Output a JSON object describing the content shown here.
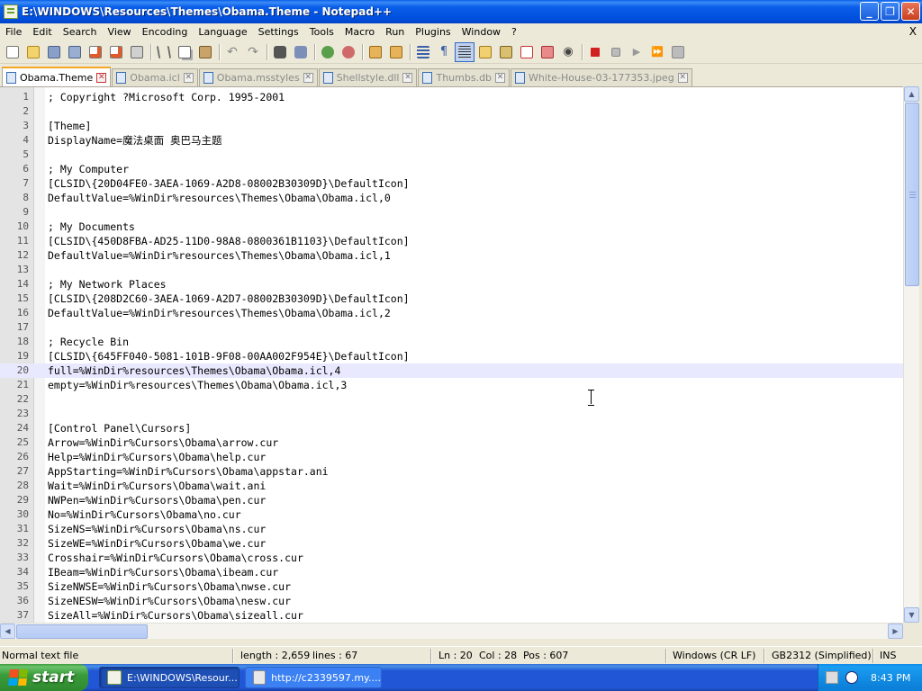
{
  "window": {
    "title": "E:\\WINDOWS\\Resources\\Themes\\Obama.Theme - Notepad++",
    "min_label": "_",
    "max_label": "❐",
    "close_label": "✕"
  },
  "menu": {
    "items": [
      "File",
      "Edit",
      "Search",
      "View",
      "Encoding",
      "Language",
      "Settings",
      "Tools",
      "Macro",
      "Run",
      "Plugins",
      "Window",
      "?"
    ],
    "close_label": "X"
  },
  "toolbar": {
    "icons": [
      "new-file-icon",
      "open-file-icon",
      "save-icon",
      "save-all-icon",
      "close-icon",
      "close-all-icon",
      "print-icon",
      "cut-icon",
      "copy-icon",
      "paste-icon",
      "undo-icon",
      "redo-icon",
      "find-icon",
      "replace-icon",
      "zoom-in-icon",
      "zoom-out-icon",
      "sync-vertical-icon",
      "sync-horizontal-icon",
      "word-wrap-icon",
      "show-all-chars-icon",
      "indent-guide-icon",
      "user-lang-icon",
      "doc-map-icon",
      "function-list-icon",
      "folder-workspace-icon",
      "monitoring-icon",
      "record-macro-icon",
      "stop-record-icon",
      "play-macro-icon",
      "play-multiple-icon",
      "save-macro-icon"
    ]
  },
  "tabs": [
    {
      "label": "Obama.Theme",
      "active": true
    },
    {
      "label": "Obama.icl",
      "active": false
    },
    {
      "label": "Obama.msstyles",
      "active": false
    },
    {
      "label": "Shellstyle.dll",
      "active": false
    },
    {
      "label": "Thumbs.db",
      "active": false
    },
    {
      "label": "White-House-03-177353.jpeg",
      "active": false
    }
  ],
  "editor": {
    "current_line": 20,
    "lines": [
      {
        "n": "1",
        "text": "; Copyright ?Microsoft Corp. 1995-2001"
      },
      {
        "n": "2",
        "text": ""
      },
      {
        "n": "3",
        "text": "[Theme]"
      },
      {
        "n": "4",
        "text": "DisplayName=魔法桌面 奥巴马主题"
      },
      {
        "n": "5",
        "text": ""
      },
      {
        "n": "6",
        "text": "; My Computer"
      },
      {
        "n": "7",
        "text": "[CLSID\\{20D04FE0-3AEA-1069-A2D8-08002B30309D}\\DefaultIcon]"
      },
      {
        "n": "8",
        "text": "DefaultValue=%WinDir%resources\\Themes\\Obama\\Obama.icl,0"
      },
      {
        "n": "9",
        "text": ""
      },
      {
        "n": "10",
        "text": "; My Documents"
      },
      {
        "n": "11",
        "text": "[CLSID\\{450D8FBA-AD25-11D0-98A8-0800361B1103}\\DefaultIcon]"
      },
      {
        "n": "12",
        "text": "DefaultValue=%WinDir%resources\\Themes\\Obama\\Obama.icl,1"
      },
      {
        "n": "13",
        "text": ""
      },
      {
        "n": "14",
        "text": "; My Network Places"
      },
      {
        "n": "15",
        "text": "[CLSID\\{208D2C60-3AEA-1069-A2D7-08002B30309D}\\DefaultIcon]"
      },
      {
        "n": "16",
        "text": "DefaultValue=%WinDir%resources\\Themes\\Obama\\Obama.icl,2"
      },
      {
        "n": "17",
        "text": ""
      },
      {
        "n": "18",
        "text": "; Recycle Bin"
      },
      {
        "n": "19",
        "text": "[CLSID\\{645FF040-5081-101B-9F08-00AA002F954E}\\DefaultIcon]"
      },
      {
        "n": "20",
        "text": "full=%WinDir%resources\\Themes\\Obama\\Obama.icl,4"
      },
      {
        "n": "21",
        "text": "empty=%WinDir%resources\\Themes\\Obama\\Obama.icl,3"
      },
      {
        "n": "22",
        "text": ""
      },
      {
        "n": "23",
        "text": ""
      },
      {
        "n": "24",
        "text": "[Control Panel\\Cursors]"
      },
      {
        "n": "25",
        "text": "Arrow=%WinDir%Cursors\\Obama\\arrow.cur"
      },
      {
        "n": "26",
        "text": "Help=%WinDir%Cursors\\Obama\\help.cur"
      },
      {
        "n": "27",
        "text": "AppStarting=%WinDir%Cursors\\Obama\\appstar.ani"
      },
      {
        "n": "28",
        "text": "Wait=%WinDir%Cursors\\Obama\\wait.ani"
      },
      {
        "n": "29",
        "text": "NWPen=%WinDir%Cursors\\Obama\\pen.cur"
      },
      {
        "n": "30",
        "text": "No=%WinDir%Cursors\\Obama\\no.cur"
      },
      {
        "n": "31",
        "text": "SizeNS=%WinDir%Cursors\\Obama\\ns.cur"
      },
      {
        "n": "32",
        "text": "SizeWE=%WinDir%Cursors\\Obama\\we.cur"
      },
      {
        "n": "33",
        "text": "Crosshair=%WinDir%Cursors\\Obama\\cross.cur"
      },
      {
        "n": "34",
        "text": "IBeam=%WinDir%Cursors\\Obama\\ibeam.cur"
      },
      {
        "n": "35",
        "text": "SizeNWSE=%WinDir%Cursors\\Obama\\nwse.cur"
      },
      {
        "n": "36",
        "text": "SizeNESW=%WinDir%Cursors\\Obama\\nesw.cur"
      },
      {
        "n": "37",
        "text": "SizeAll=%WinDir%Cursors\\Obama\\sizeall.cur"
      }
    ]
  },
  "status": {
    "file_type": "Normal text file",
    "length": "length : 2,659",
    "lines": "lines : 67",
    "ln": "Ln : 20",
    "col": "Col : 28",
    "pos": "Pos : 607",
    "eol": "Windows (CR LF)",
    "encoding": "GB2312 (Simplified)",
    "mode": "INS"
  },
  "taskbar": {
    "start_label": "start",
    "items": [
      {
        "label": "E:\\WINDOWS\\Resour...",
        "active": true
      },
      {
        "label": "http://c2339597.my....",
        "active": false
      }
    ],
    "clock": "8:43 PM"
  },
  "colors": {
    "current_line_bg": "#e8e8ff",
    "titlebar": "#0a5ee8",
    "taskbar": "#2157d7",
    "start_green": "#3a9c3a"
  }
}
